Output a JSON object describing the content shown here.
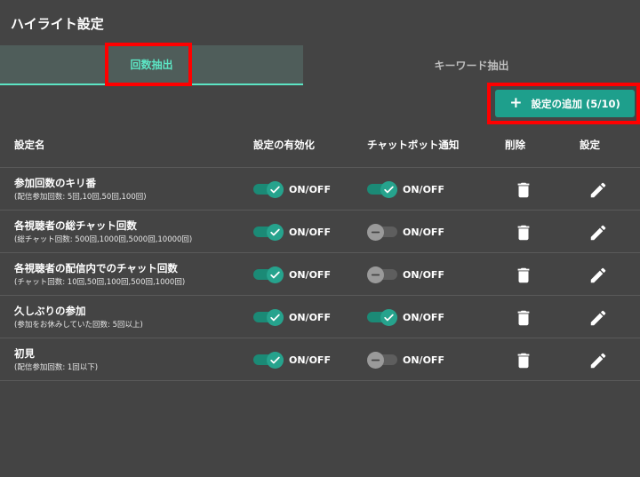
{
  "title": "ハイライト設定",
  "tabs": [
    {
      "label": "回数抽出"
    },
    {
      "label": "キーワード抽出"
    }
  ],
  "add_button": {
    "label": "設定の追加 (5/10)"
  },
  "columns": {
    "name": "設定名",
    "enable": "設定の有効化",
    "chatbot": "チャットボット通知",
    "delete": "削除",
    "settings": "設定"
  },
  "colors": {
    "accent": "#1e9f8c",
    "highlight": "#ff0000",
    "active_tab_text": "#5ce5c4"
  },
  "rows": [
    {
      "name": "参加回数のキリ番",
      "sub": "(配信参加回数: 5回,10回,50回,100回)",
      "enable": true,
      "chatbot": true,
      "enable_label": "ON/OFF",
      "chatbot_label": "ON/OFF"
    },
    {
      "name": "各視聴者の総チャット回数",
      "sub": "(総チャット回数: 500回,1000回,5000回,10000回)",
      "enable": true,
      "chatbot": false,
      "enable_label": "ON/OFF",
      "chatbot_label": "ON/OFF"
    },
    {
      "name": "各視聴者の配信内でのチャット回数",
      "sub": "(チャット回数: 10回,50回,100回,500回,1000回)",
      "enable": true,
      "chatbot": false,
      "enable_label": "ON/OFF",
      "chatbot_label": "ON/OFF"
    },
    {
      "name": "久しぶりの参加",
      "sub": "(参加をお休みしていた回数: 5回以上)",
      "enable": true,
      "chatbot": true,
      "enable_label": "ON/OFF",
      "chatbot_label": "ON/OFF"
    },
    {
      "name": "初見",
      "sub": "(配信参加回数: 1回以下)",
      "enable": true,
      "chatbot": false,
      "enable_label": "ON/OFF",
      "chatbot_label": "ON/OFF"
    }
  ]
}
